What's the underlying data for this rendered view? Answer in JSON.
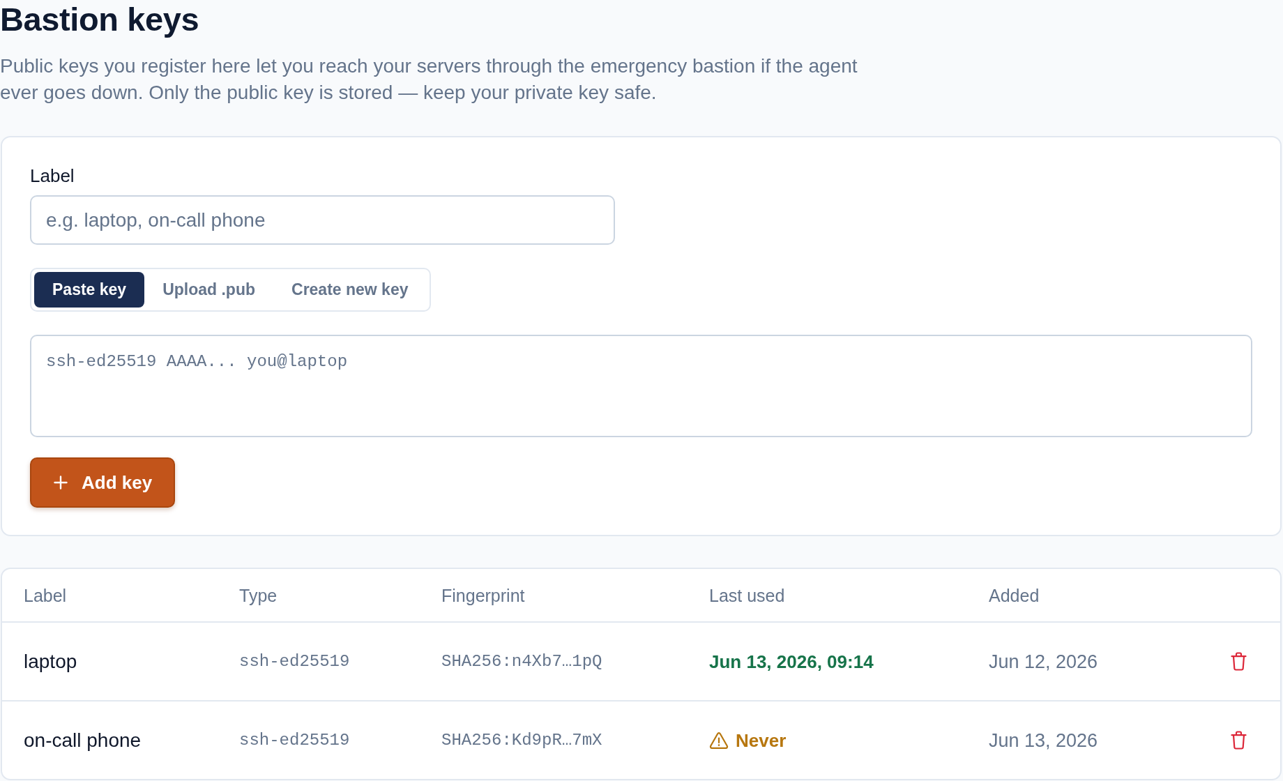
{
  "page": {
    "title": "Bastion keys",
    "description": "Public keys you register here let you reach your servers through the emergency bastion if the agent ever goes down. Only the public key is stored — keep your private key safe."
  },
  "form": {
    "label_field": {
      "label": "Label",
      "placeholder": "e.g. laptop, on-call phone"
    },
    "tabs": [
      {
        "label": "Paste key",
        "selected": true
      },
      {
        "label": "Upload .pub",
        "selected": false
      },
      {
        "label": "Create new key",
        "selected": false
      }
    ],
    "key_field": {
      "placeholder": "ssh-ed25519 AAAA... you@laptop"
    },
    "submit_button": {
      "label": "Add key"
    }
  },
  "table": {
    "columns": [
      "Label",
      "Type",
      "Fingerprint",
      "Last used",
      "Added"
    ],
    "rows": [
      {
        "label": "laptop",
        "type": "ssh-ed25519",
        "fingerprint": "SHA256:n4Xb7…1pQ",
        "last_used": {
          "kind": "recent",
          "text": "Jun 13, 2026, 09:14"
        },
        "added": "Jun 12, 2026"
      },
      {
        "label": "on-call phone",
        "type": "ssh-ed25519",
        "fingerprint": "SHA256:Kd9pR…7mX",
        "last_used": {
          "kind": "never",
          "text": "Never"
        },
        "added": "Jun 13, 2026"
      }
    ]
  }
}
